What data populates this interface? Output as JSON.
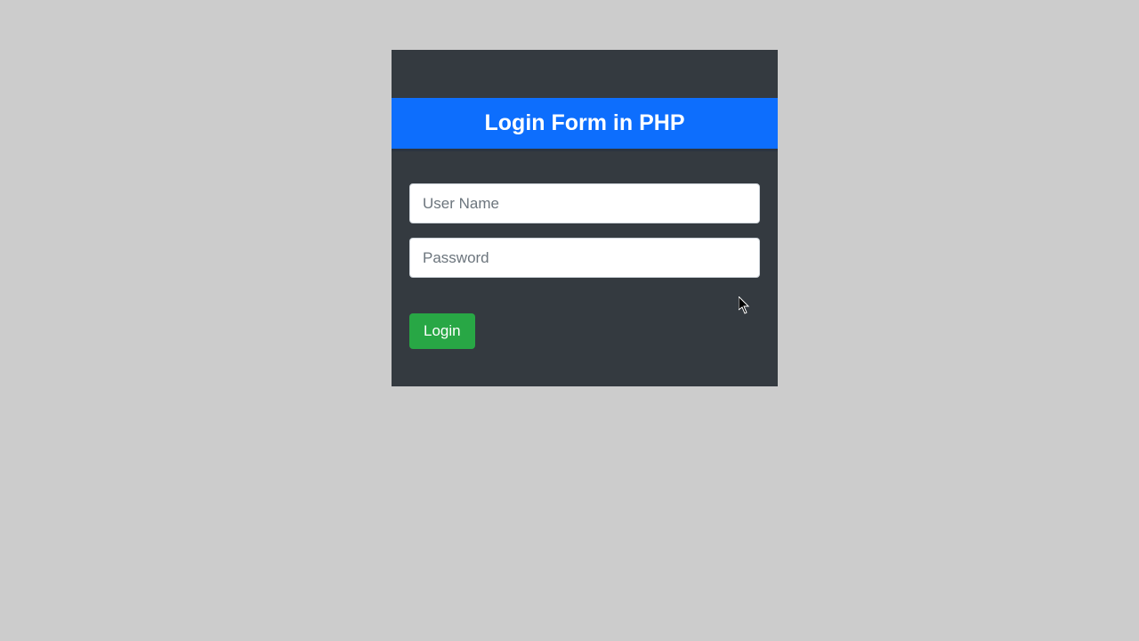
{
  "header": {
    "title": "Login Form in PHP"
  },
  "form": {
    "username": {
      "placeholder": "User Name",
      "value": ""
    },
    "password": {
      "placeholder": "Password",
      "value": ""
    },
    "submit_label": "Login"
  },
  "colors": {
    "card_bg": "#343a40",
    "header_bg": "#0d6efd",
    "button_bg": "#28a745",
    "page_bg": "#cccccc"
  }
}
